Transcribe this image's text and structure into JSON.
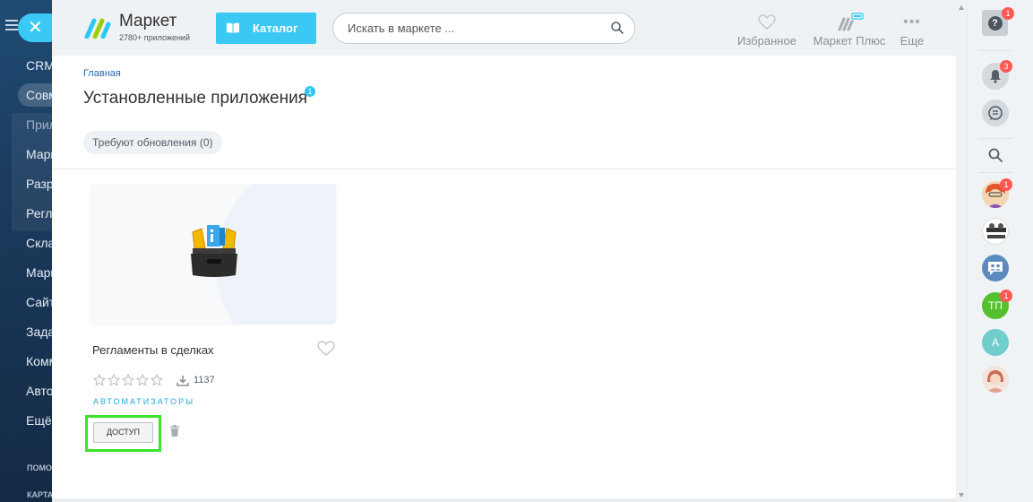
{
  "left_nav": {
    "items": [
      "CRM",
      "Совм",
      "Прил",
      "Марк",
      "Разр",
      "Регл",
      "Скла",
      "Марк",
      "Сайт",
      "Зада",
      "Комм",
      "Авто",
      "Ещё"
    ],
    "small_labels": [
      "ПОМО",
      "КАРТА"
    ]
  },
  "header": {
    "logo_title": "Маркет",
    "logo_subtitle": "2780+ приложений",
    "catalog_label": "Каталог",
    "search_placeholder": "Искать в маркете ...",
    "actions": [
      {
        "label": "Избранное",
        "icon": "heart-icon"
      },
      {
        "label": "Маркет Плюс",
        "icon": "market-plus-icon"
      },
      {
        "label": "Еще",
        "icon": "more-icon"
      }
    ]
  },
  "breadcrumb": "Главная",
  "page_title": "Установленные приложения",
  "title_badge": "1",
  "filter": "Требуют обновления (0)",
  "app": {
    "name": "Регламенты в сделках",
    "rating": 0,
    "rating_max": 5,
    "downloads": "1137",
    "vendor": "АВТОМАТИЗАТОРЫ",
    "access_label": "ДОСТУП"
  },
  "right_sidebar": {
    "help_badge": "1",
    "notifications_badge": "3",
    "avatar1_badge": "1",
    "tp_label": "ТП",
    "tp_badge": "1",
    "a_label": "А"
  },
  "colors": {
    "accent": "#3bc8f5",
    "highlight": "#3be42a",
    "badge": "#ff5752",
    "vendor": "#1fa8d5"
  }
}
